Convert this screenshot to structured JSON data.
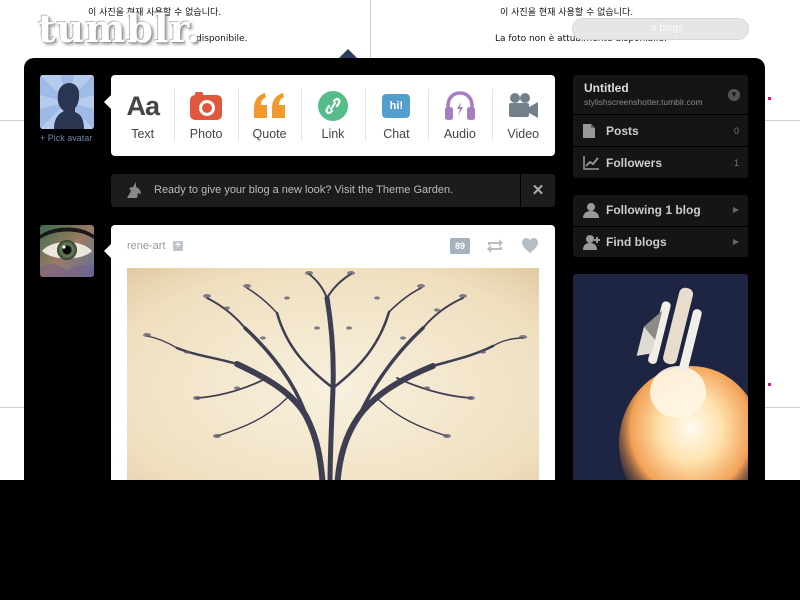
{
  "background_page": {
    "unavailable_korean": "이 사진을 현재 사용할 수 없습니다.",
    "unavailable_italian": "La foto non è attualmente disponibile.",
    "unavailable_italian_cut": "disponibile.",
    "logo": "tumblr.",
    "search_placeholder": "a blogs"
  },
  "dashboard": {
    "pick_avatar": "+ Pick avatar",
    "post_types": [
      {
        "label": "Text",
        "icon": "text-icon",
        "glyph": "Aa"
      },
      {
        "label": "Photo",
        "icon": "camera-icon",
        "color": "#e1573b"
      },
      {
        "label": "Quote",
        "icon": "quote-icon",
        "color": "#f2992e"
      },
      {
        "label": "Link",
        "icon": "link-icon",
        "color": "#56bc8a"
      },
      {
        "label": "Chat",
        "icon": "chat-icon",
        "glyph": "hi!",
        "color": "#529ecc"
      },
      {
        "label": "Audio",
        "icon": "headphones-icon",
        "color": "#a77dc2"
      },
      {
        "label": "Video",
        "icon": "video-camera-icon",
        "color": "#748089"
      }
    ],
    "banner": {
      "text": "Ready to give your blog a new look? Visit the Theme Garden.",
      "close": "✕"
    },
    "post": {
      "author": "rene-art",
      "follow_glyph": "+",
      "notes": "89"
    }
  },
  "sidebar": {
    "blog_title": "Untitled",
    "blog_url": "stylishscreenshotter.tumblr.com",
    "blog_menu": "▼",
    "items": [
      {
        "label": "Posts",
        "count": "0"
      },
      {
        "label": "Followers",
        "count": "1"
      }
    ],
    "follow_items": [
      {
        "label": "Following 1 blog",
        "arrow": "▶"
      },
      {
        "label": "Find blogs",
        "arrow": "▶"
      }
    ]
  },
  "colors": {
    "accent_blue": "#529ecc",
    "dashboard_bg": "#000000",
    "sidebar_bg": "#151515"
  }
}
